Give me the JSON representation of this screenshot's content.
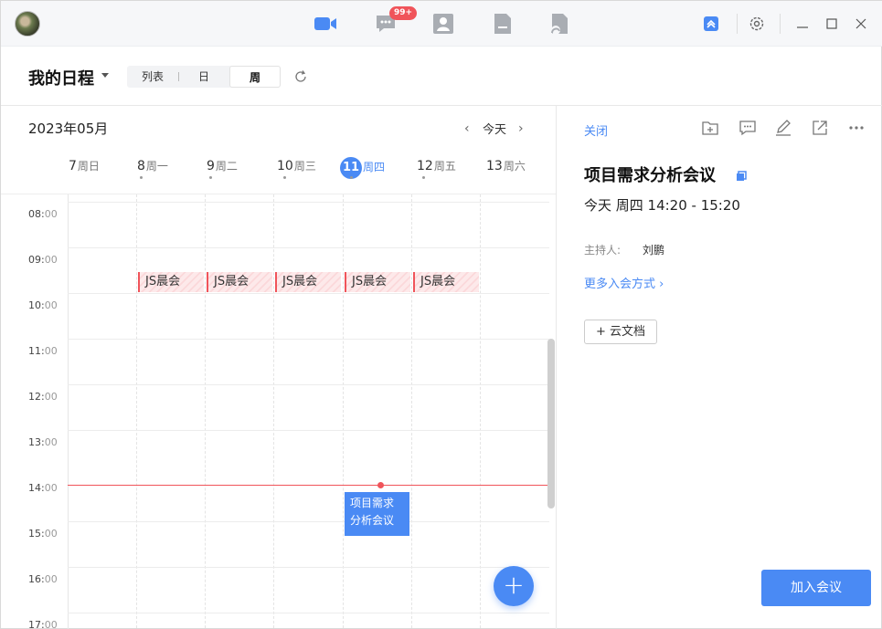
{
  "titlebar": {
    "badge_count": "99+",
    "nav_icons": [
      "video-icon",
      "chat-icon",
      "contacts-icon",
      "docs-icon",
      "cloud-drive-icon"
    ],
    "window_controls": [
      "minimize-icon",
      "maximize-icon",
      "close-icon"
    ]
  },
  "header": {
    "title": "我的日程",
    "views": [
      "列表",
      "日",
      "周"
    ],
    "active_view": "周"
  },
  "calendar": {
    "month_label": "2023年05月",
    "today_label": "今天",
    "days": [
      {
        "num": "7",
        "weekday": "周日"
      },
      {
        "num": "8",
        "weekday": "周一"
      },
      {
        "num": "9",
        "weekday": "周二"
      },
      {
        "num": "10",
        "weekday": "周三"
      },
      {
        "num": "11",
        "weekday": "周四"
      },
      {
        "num": "12",
        "weekday": "周五"
      },
      {
        "num": "13",
        "weekday": "周六"
      }
    ],
    "hours": [
      {
        "h": "08",
        "m": "00"
      },
      {
        "h": "09",
        "m": "00"
      },
      {
        "h": "10",
        "m": "00"
      },
      {
        "h": "11",
        "m": "00"
      },
      {
        "h": "12",
        "m": "00"
      },
      {
        "h": "13",
        "m": "00"
      },
      {
        "h": "14",
        "m": "00"
      },
      {
        "h": "15",
        "m": "00"
      },
      {
        "h": "16",
        "m": "00"
      },
      {
        "h": "17",
        "m": "00"
      }
    ],
    "recurring_event": "JS晨会",
    "meeting_line1": "项目需求",
    "meeting_line2": "分析会议",
    "fab_label": "+"
  },
  "detail": {
    "close_label": "关闭",
    "title": "项目需求分析会议",
    "time": "今天 周四 14:20 - 15:20",
    "host_label": "主持人:",
    "host_name": "刘鹏",
    "more_join": "更多入会方式 ›",
    "cloud_doc": "+ 云文档",
    "join_button": "加入会议"
  },
  "colors": {
    "accent": "#4a8af4",
    "now_line": "#f0545a",
    "badge": "#f0545a"
  }
}
